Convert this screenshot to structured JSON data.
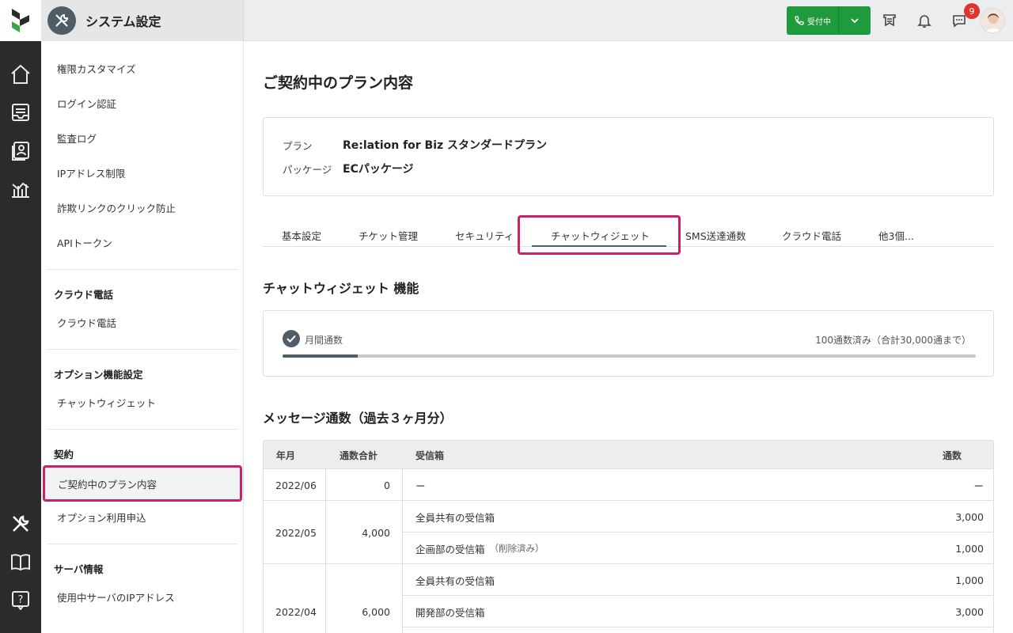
{
  "header": {
    "section_title": "システム設定",
    "phone_status": "受付中",
    "notification_count": "9",
    "accent": "#1f9a3c"
  },
  "sidebar": {
    "items_top": [
      "権限カスタマイズ",
      "ログイン認証",
      "監査ログ",
      "IPアドレス制限",
      "詐欺リンクのクリック防止",
      "APIトークン"
    ],
    "groups": [
      {
        "heading": "クラウド電話",
        "items": [
          "クラウド電話"
        ]
      },
      {
        "heading": "オプション機能設定",
        "items": [
          "チャットウィジェット"
        ]
      },
      {
        "heading": "契約",
        "items": [
          "ご契約中のプラン内容",
          "オプション利用申込"
        ]
      },
      {
        "heading": "サーバ情報",
        "items": [
          "使用中サーバのIPアドレス"
        ]
      }
    ]
  },
  "main": {
    "title": "ご契約中のプラン内容",
    "plan": {
      "plan_label": "プラン",
      "plan_value": "Re:lation for Biz スタンダードプラン",
      "package_label": "パッケージ",
      "package_value": "ECパッケージ"
    },
    "tabs": [
      "基本設定",
      "チケット管理",
      "セキュリティ",
      "チャットウィジェット",
      "SMS送達通数",
      "クラウド電話",
      "他3個..."
    ],
    "active_tab": "チャットウィジェット",
    "feature_title": "チャットウィジェット 機能",
    "usage": {
      "label": "月間通数",
      "count_text": "100通数済み（合計30,000通まで）",
      "used": 100,
      "limit": 30000,
      "bar_fraction": 0.108
    },
    "messages_title": "メッセージ通数（過去３ヶ月分）",
    "table": {
      "headers": [
        "年月",
        "通数合計",
        "受信箱",
        "通数"
      ],
      "rows": [
        {
          "month": "2022/06",
          "total": "0",
          "inboxes": [
            {
              "name": "ー",
              "note": "",
              "count": "ー"
            }
          ]
        },
        {
          "month": "2022/05",
          "total": "4,000",
          "inboxes": [
            {
              "name": "全員共有の受信箱",
              "note": "",
              "count": "3,000"
            },
            {
              "name": "企画部の受信箱",
              "note": "（削除済み）",
              "count": "1,000"
            }
          ]
        },
        {
          "month": "2022/04",
          "total": "6,000",
          "inboxes": [
            {
              "name": "全員共有の受信箱",
              "note": "",
              "count": "1,000"
            },
            {
              "name": "開発部の受信箱",
              "note": "",
              "count": "3,000"
            }
          ]
        }
      ]
    }
  }
}
